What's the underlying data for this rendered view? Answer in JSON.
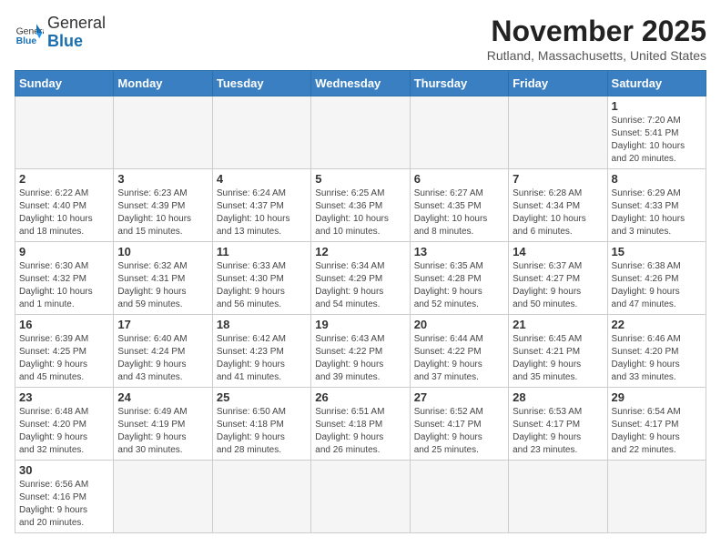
{
  "header": {
    "logo_general": "General",
    "logo_blue": "Blue",
    "title": "November 2025",
    "location": "Rutland, Massachusetts, United States"
  },
  "days_of_week": [
    "Sunday",
    "Monday",
    "Tuesday",
    "Wednesday",
    "Thursday",
    "Friday",
    "Saturday"
  ],
  "weeks": [
    [
      {
        "day": "",
        "info": ""
      },
      {
        "day": "",
        "info": ""
      },
      {
        "day": "",
        "info": ""
      },
      {
        "day": "",
        "info": ""
      },
      {
        "day": "",
        "info": ""
      },
      {
        "day": "",
        "info": ""
      },
      {
        "day": "1",
        "info": "Sunrise: 7:20 AM\nSunset: 5:41 PM\nDaylight: 10 hours\nand 20 minutes."
      }
    ],
    [
      {
        "day": "2",
        "info": "Sunrise: 6:22 AM\nSunset: 4:40 PM\nDaylight: 10 hours\nand 18 minutes."
      },
      {
        "day": "3",
        "info": "Sunrise: 6:23 AM\nSunset: 4:39 PM\nDaylight: 10 hours\nand 15 minutes."
      },
      {
        "day": "4",
        "info": "Sunrise: 6:24 AM\nSunset: 4:37 PM\nDaylight: 10 hours\nand 13 minutes."
      },
      {
        "day": "5",
        "info": "Sunrise: 6:25 AM\nSunset: 4:36 PM\nDaylight: 10 hours\nand 10 minutes."
      },
      {
        "day": "6",
        "info": "Sunrise: 6:27 AM\nSunset: 4:35 PM\nDaylight: 10 hours\nand 8 minutes."
      },
      {
        "day": "7",
        "info": "Sunrise: 6:28 AM\nSunset: 4:34 PM\nDaylight: 10 hours\nand 6 minutes."
      },
      {
        "day": "8",
        "info": "Sunrise: 6:29 AM\nSunset: 4:33 PM\nDaylight: 10 hours\nand 3 minutes."
      }
    ],
    [
      {
        "day": "9",
        "info": "Sunrise: 6:30 AM\nSunset: 4:32 PM\nDaylight: 10 hours\nand 1 minute."
      },
      {
        "day": "10",
        "info": "Sunrise: 6:32 AM\nSunset: 4:31 PM\nDaylight: 9 hours\nand 59 minutes."
      },
      {
        "day": "11",
        "info": "Sunrise: 6:33 AM\nSunset: 4:30 PM\nDaylight: 9 hours\nand 56 minutes."
      },
      {
        "day": "12",
        "info": "Sunrise: 6:34 AM\nSunset: 4:29 PM\nDaylight: 9 hours\nand 54 minutes."
      },
      {
        "day": "13",
        "info": "Sunrise: 6:35 AM\nSunset: 4:28 PM\nDaylight: 9 hours\nand 52 minutes."
      },
      {
        "day": "14",
        "info": "Sunrise: 6:37 AM\nSunset: 4:27 PM\nDaylight: 9 hours\nand 50 minutes."
      },
      {
        "day": "15",
        "info": "Sunrise: 6:38 AM\nSunset: 4:26 PM\nDaylight: 9 hours\nand 47 minutes."
      }
    ],
    [
      {
        "day": "16",
        "info": "Sunrise: 6:39 AM\nSunset: 4:25 PM\nDaylight: 9 hours\nand 45 minutes."
      },
      {
        "day": "17",
        "info": "Sunrise: 6:40 AM\nSunset: 4:24 PM\nDaylight: 9 hours\nand 43 minutes."
      },
      {
        "day": "18",
        "info": "Sunrise: 6:42 AM\nSunset: 4:23 PM\nDaylight: 9 hours\nand 41 minutes."
      },
      {
        "day": "19",
        "info": "Sunrise: 6:43 AM\nSunset: 4:22 PM\nDaylight: 9 hours\nand 39 minutes."
      },
      {
        "day": "20",
        "info": "Sunrise: 6:44 AM\nSunset: 4:22 PM\nDaylight: 9 hours\nand 37 minutes."
      },
      {
        "day": "21",
        "info": "Sunrise: 6:45 AM\nSunset: 4:21 PM\nDaylight: 9 hours\nand 35 minutes."
      },
      {
        "day": "22",
        "info": "Sunrise: 6:46 AM\nSunset: 4:20 PM\nDaylight: 9 hours\nand 33 minutes."
      }
    ],
    [
      {
        "day": "23",
        "info": "Sunrise: 6:48 AM\nSunset: 4:20 PM\nDaylight: 9 hours\nand 32 minutes."
      },
      {
        "day": "24",
        "info": "Sunrise: 6:49 AM\nSunset: 4:19 PM\nDaylight: 9 hours\nand 30 minutes."
      },
      {
        "day": "25",
        "info": "Sunrise: 6:50 AM\nSunset: 4:18 PM\nDaylight: 9 hours\nand 28 minutes."
      },
      {
        "day": "26",
        "info": "Sunrise: 6:51 AM\nSunset: 4:18 PM\nDaylight: 9 hours\nand 26 minutes."
      },
      {
        "day": "27",
        "info": "Sunrise: 6:52 AM\nSunset: 4:17 PM\nDaylight: 9 hours\nand 25 minutes."
      },
      {
        "day": "28",
        "info": "Sunrise: 6:53 AM\nSunset: 4:17 PM\nDaylight: 9 hours\nand 23 minutes."
      },
      {
        "day": "29",
        "info": "Sunrise: 6:54 AM\nSunset: 4:17 PM\nDaylight: 9 hours\nand 22 minutes."
      }
    ],
    [
      {
        "day": "30",
        "info": "Sunrise: 6:56 AM\nSunset: 4:16 PM\nDaylight: 9 hours\nand 20 minutes."
      },
      {
        "day": "",
        "info": ""
      },
      {
        "day": "",
        "info": ""
      },
      {
        "day": "",
        "info": ""
      },
      {
        "day": "",
        "info": ""
      },
      {
        "day": "",
        "info": ""
      },
      {
        "day": "",
        "info": ""
      }
    ]
  ]
}
